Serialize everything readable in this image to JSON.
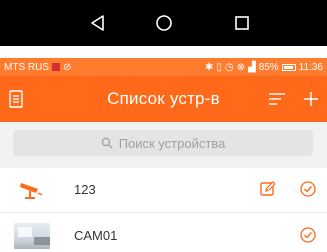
{
  "navigation_bar": {
    "back": "back-triangle",
    "home": "home-circle",
    "recent": "recent-square"
  },
  "status_bar": {
    "carrier": "MTS RUS",
    "indicators": "bluetooth, vibrate, alarm, no-sim, signal",
    "battery": "85%",
    "time": "11:36"
  },
  "app_bar": {
    "title": "Список устр-в",
    "accent_color": "#ff6a1a"
  },
  "search": {
    "placeholder": "Поиск устройства"
  },
  "devices": [
    {
      "name": "123",
      "icon": "camera-icon",
      "editable": true,
      "selected": true
    },
    {
      "name": "CAM01",
      "icon": "thumbnail",
      "editable": false,
      "selected": true
    }
  ]
}
